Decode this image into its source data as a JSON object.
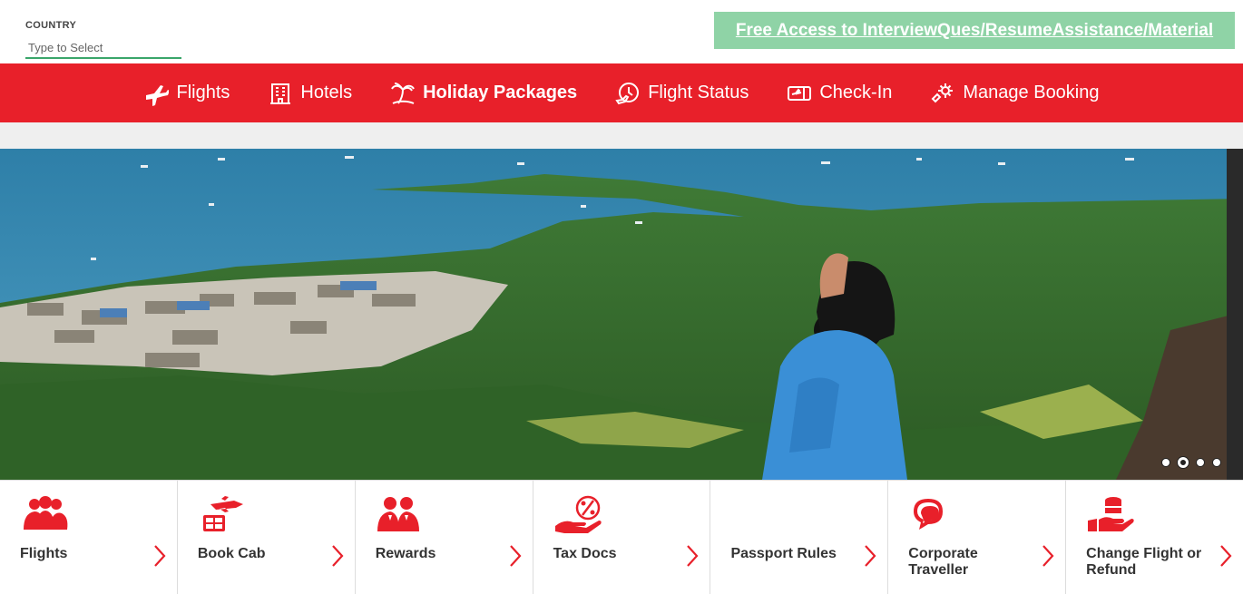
{
  "country": {
    "label": "COUNTRY",
    "placeholder": "Type to Select"
  },
  "promo": {
    "text": "Free Access to InterviewQues/ResumeAssistance/Material"
  },
  "nav": {
    "items": [
      {
        "label": "Flights",
        "icon": "plane-icon"
      },
      {
        "label": "Hotels",
        "icon": "hotel-icon"
      },
      {
        "label": "Holiday Packages",
        "icon": "palm-tree-icon",
        "active": true
      },
      {
        "label": "Flight Status",
        "icon": "flight-status-icon"
      },
      {
        "label": "Check-In",
        "icon": "boarding-pass-icon"
      },
      {
        "label": "Manage Booking",
        "icon": "gear-icon"
      }
    ]
  },
  "carousel": {
    "slide_count": 4,
    "active_index": 1
  },
  "tiles": [
    {
      "label": "Flights",
      "icon": "group-icon"
    },
    {
      "label": "Book Cab",
      "icon": "cab-icon"
    },
    {
      "label": "Rewards",
      "icon": "people-icon"
    },
    {
      "label": "Tax Docs",
      "icon": "percent-hand-icon"
    },
    {
      "label": "Passport Rules",
      "icon": "passport-icon"
    },
    {
      "label": "Corporate Traveller",
      "icon": "chat-icon"
    },
    {
      "label": "Change Flight or Refund",
      "icon": "refund-icon"
    }
  ],
  "colors": {
    "brand_red": "#e8202a",
    "promo_green": "#8fd3a6",
    "input_underline": "#3aa66a"
  }
}
